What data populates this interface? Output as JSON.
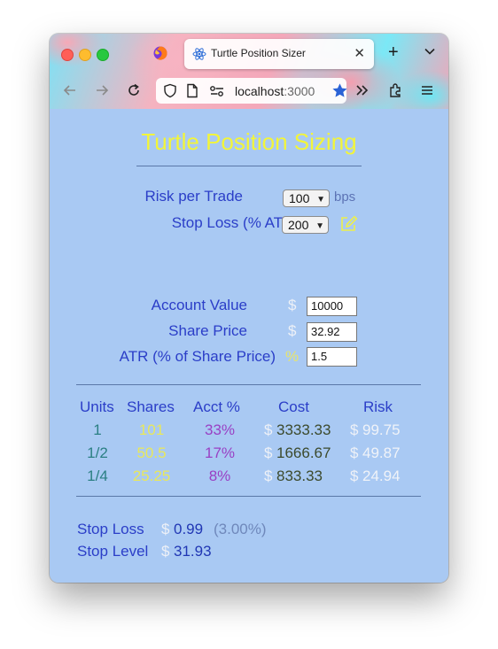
{
  "browser": {
    "tab_title": "Turtle Position Sizer",
    "tab_close": "✕",
    "new_tab": "+",
    "url_host": "localhost",
    "url_port": ":3000"
  },
  "page": {
    "title": "Turtle Position Sizing",
    "risk_label": "Risk per Trade",
    "risk_value": "100",
    "risk_unit": "bps",
    "stop_label": "Stop Loss (% ATR)",
    "stop_value": "200",
    "account_label": "Account Value",
    "account_value": "10000",
    "price_label": "Share Price",
    "price_value": "32.92",
    "atr_label": "ATR (% of Share Price)",
    "atr_value": "1.5",
    "dollar_symbol": "$",
    "percent_symbol": "%"
  },
  "table": {
    "headers": {
      "units": "Units",
      "shares": "Shares",
      "acct": "Acct %",
      "cost": "Cost",
      "risk": "Risk"
    },
    "rows": [
      {
        "units": "1",
        "shares": "101",
        "acct": "33%",
        "cost": "3333.33",
        "risk": "99.75"
      },
      {
        "units": "1/2",
        "shares": "50.5",
        "acct": "17%",
        "cost": "1666.67",
        "risk": "49.87"
      },
      {
        "units": "1/4",
        "shares": "25.25",
        "acct": "8%",
        "cost": "833.33",
        "risk": "24.94"
      }
    ]
  },
  "summary": {
    "stop_loss_label": "Stop Loss",
    "stop_loss_value": "0.99",
    "stop_loss_pct": "(3.00%)",
    "stop_level_label": "Stop Level",
    "stop_level_value": "31.93"
  },
  "colors": {
    "page_background": "#a9c9f3",
    "title": "#f2f53a",
    "label": "#2b3ec8",
    "units": "#2b7f83",
    "shares": "#e9e85a",
    "acct": "#9940c4",
    "cost": "#3c4a2c",
    "risk": "#f0f3f8"
  },
  "icons": {
    "traffic_lights": [
      "close-window",
      "minimize-window",
      "zoom-window"
    ],
    "tab": "react-logo-icon",
    "toolbar": [
      "back-arrow-icon",
      "forward-arrow-icon",
      "reload-icon",
      "shield-icon",
      "page-icon",
      "permissions-icon",
      "bookmark-star-icon",
      "overflow-chevrons-icon",
      "extensions-icon",
      "menu-icon"
    ],
    "edit": "edit-pencil-icon"
  }
}
